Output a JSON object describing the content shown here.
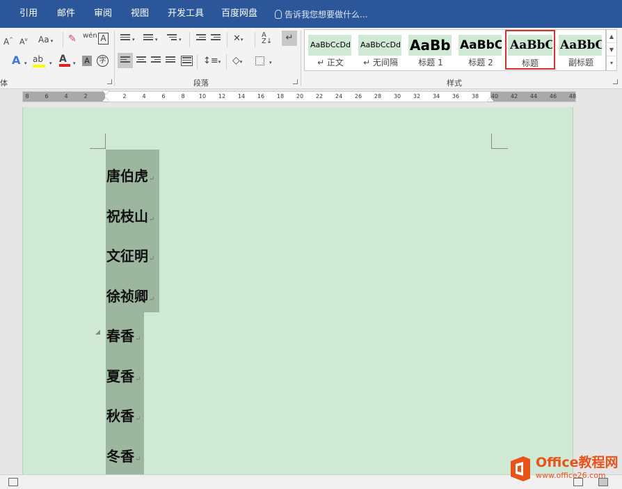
{
  "menu": {
    "items": [
      "引用",
      "邮件",
      "审阅",
      "视图",
      "开发工具",
      "百度网盘"
    ],
    "tell_me": "告诉我您想要做什么..."
  },
  "ribbon": {
    "font_group": {
      "label": "体",
      "change_case": "Aa",
      "phonetic": "wén",
      "border_char": "A",
      "enclose": "字"
    },
    "paragraph_group": {
      "label": "段落"
    },
    "styles_group": {
      "label": "样式",
      "styles": [
        {
          "preview": "AaBbCcDd",
          "name": "↵ 正文"
        },
        {
          "preview": "AaBbCcDd",
          "name": "↵ 无间隔"
        },
        {
          "preview": "AaBb",
          "name": "标题 1"
        },
        {
          "preview": "AaBbC",
          "name": "标题 2"
        },
        {
          "preview": "AaBbC",
          "name": "标题",
          "selected": true
        },
        {
          "preview": "AaBbC",
          "name": "副标题"
        }
      ]
    }
  },
  "ruler": {
    "left_ticks": [
      "8",
      "6",
      "4",
      "2"
    ],
    "right_ticks": [
      "2",
      "4",
      "6",
      "8",
      "10",
      "12",
      "14",
      "16",
      "18",
      "20",
      "22",
      "24",
      "26",
      "28",
      "30",
      "32",
      "34",
      "36",
      "38",
      "40",
      "42",
      "44",
      "46",
      "48"
    ]
  },
  "document": {
    "lines": [
      "唐伯虎",
      "祝枝山",
      "文征明",
      "徐祯卿",
      "春香",
      "夏香",
      "秋香",
      "冬香"
    ],
    "paragraph_mark": "↵"
  },
  "watermark": {
    "title": "Office教程网",
    "url": "www.office26.com"
  },
  "colors": {
    "menubar": "#2b579a",
    "page": "#cfe9d4",
    "selection": "#9cb69f",
    "highlight_border": "#d9302b",
    "watermark": "#e8531a"
  }
}
